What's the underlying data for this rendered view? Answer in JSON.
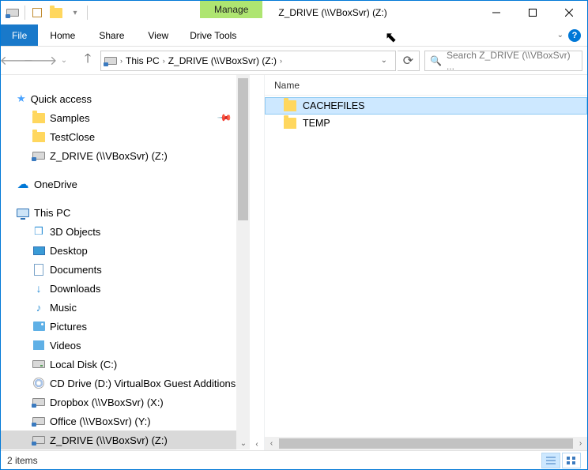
{
  "titlebar": {
    "manage_label": "Manage",
    "title": "Z_DRIVE (\\\\VBoxSvr) (Z:)"
  },
  "ribbon": {
    "file": "File",
    "tabs": [
      "Home",
      "Share",
      "View"
    ],
    "drive_tools": "Drive Tools"
  },
  "breadcrumb": {
    "segments": [
      "This PC",
      "Z_DRIVE (\\\\VBoxSvr) (Z:)"
    ]
  },
  "search": {
    "placeholder": "Search Z_DRIVE (\\\\VBoxSvr) ..."
  },
  "nav": {
    "quick_access": "Quick access",
    "qa_items": [
      {
        "label": "Samples",
        "pinned": true
      },
      {
        "label": "TestClose",
        "pinned": false
      },
      {
        "label": "Z_DRIVE (\\\\VBoxSvr) (Z:)",
        "pinned": false,
        "drive": true
      }
    ],
    "onedrive": "OneDrive",
    "this_pc": "This PC",
    "pc_items": [
      {
        "label": "3D Objects",
        "kind": "3d"
      },
      {
        "label": "Desktop",
        "kind": "desktop"
      },
      {
        "label": "Documents",
        "kind": "doc"
      },
      {
        "label": "Downloads",
        "kind": "down"
      },
      {
        "label": "Music",
        "kind": "music"
      },
      {
        "label": "Pictures",
        "kind": "pic"
      },
      {
        "label": "Videos",
        "kind": "vid"
      },
      {
        "label": "Local Disk (C:)",
        "kind": "drive"
      },
      {
        "label": "CD Drive (D:) VirtualBox Guest Additions",
        "kind": "cd"
      },
      {
        "label": "Dropbox (\\\\VBoxSvr) (X:)",
        "kind": "netdrive"
      },
      {
        "label": "Office (\\\\VBoxSvr) (Y:)",
        "kind": "netdrive"
      },
      {
        "label": "Z_DRIVE (\\\\VBoxSvr) (Z:)",
        "kind": "netdrive",
        "selected": true
      }
    ]
  },
  "content": {
    "column_name": "Name",
    "items": [
      {
        "label": "CACHEFILES",
        "selected": true
      },
      {
        "label": "TEMP",
        "selected": false
      }
    ]
  },
  "status": {
    "text": "2 items"
  }
}
